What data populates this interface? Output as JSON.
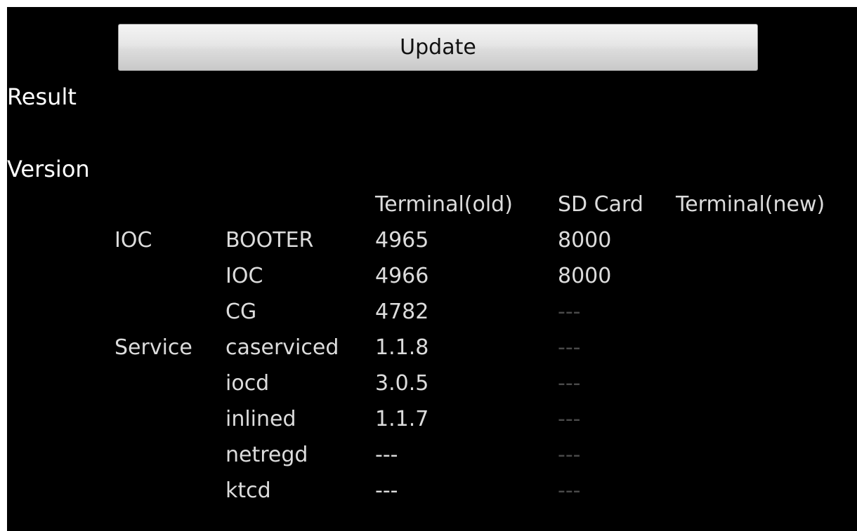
{
  "update_button": {
    "label": "Update"
  },
  "result_label": "Result",
  "version_label": "Version",
  "columns": [
    "Terminal(old)",
    "SD Card",
    "Terminal(new)"
  ],
  "rows": [
    {
      "group": "IOC",
      "name": "BOOTER",
      "terminal_old": "4965",
      "sd_card": "8000"
    },
    {
      "group": "",
      "name": "IOC",
      "terminal_old": "4966",
      "sd_card": "8000"
    },
    {
      "group": "",
      "name": "CG",
      "terminal_old": "4782",
      "sd_card": "---"
    },
    {
      "group": "Service",
      "name": "caserviced",
      "terminal_old": "1.1.8",
      "sd_card": "---"
    },
    {
      "group": "",
      "name": "iocd",
      "terminal_old": "3.0.5",
      "sd_card": "---"
    },
    {
      "group": "",
      "name": "inlined",
      "terminal_old": "1.1.7",
      "sd_card": "---"
    },
    {
      "group": "",
      "name": "netregd",
      "terminal_old": "---",
      "sd_card": "---"
    },
    {
      "group": "",
      "name": "ktcd",
      "terminal_old": "---",
      "sd_card": "---"
    }
  ]
}
